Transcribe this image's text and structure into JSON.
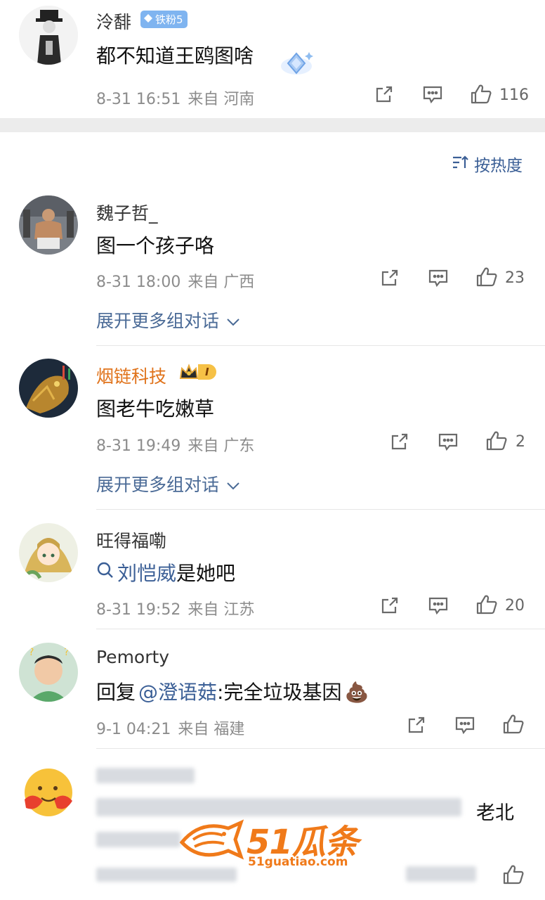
{
  "colors": {
    "link": "#3b5f96",
    "meta": "#8c8c8c",
    "vip_name": "#e0731b",
    "watermark": "#f07a1a"
  },
  "top_comment": {
    "username": "泠馡",
    "badge": "铁粉5",
    "text": "都不知道王鸥图啥",
    "date": "8-31 16:51",
    "source": "来自 河南",
    "likes": "116"
  },
  "sort_button": {
    "label": "按热度",
    "icon": "sort-icon"
  },
  "comments": [
    {
      "username": "魏子哲_",
      "text": "图一个孩子咯",
      "date": "8-31 18:00",
      "source": "来自 广西",
      "likes": "23",
      "expand": "展开更多组对话"
    },
    {
      "username": "烟链科技",
      "text": "图老牛吃嫩草",
      "date": "8-31 19:49",
      "source": "来自 广东",
      "likes": "2",
      "expand": "展开更多组对话",
      "vip_badge": "I"
    },
    {
      "username": "旺得福嘞",
      "search_link": "刘恺威",
      "text_suffix": "是她吧",
      "date": "8-31 19:52",
      "source": "来自 江苏",
      "likes": "20"
    },
    {
      "username": "Pemorty",
      "reply_prefix": "回复",
      "mention": "@澄语菇",
      "text_suffix": ":完全垃圾基因",
      "emoji": "💩",
      "date": "9-1 04:21",
      "source": "来自 福建",
      "likes": ""
    },
    {
      "visible_text": "老北"
    }
  ],
  "watermark": {
    "brand": "51瓜条",
    "url": "51guatiao.com"
  }
}
